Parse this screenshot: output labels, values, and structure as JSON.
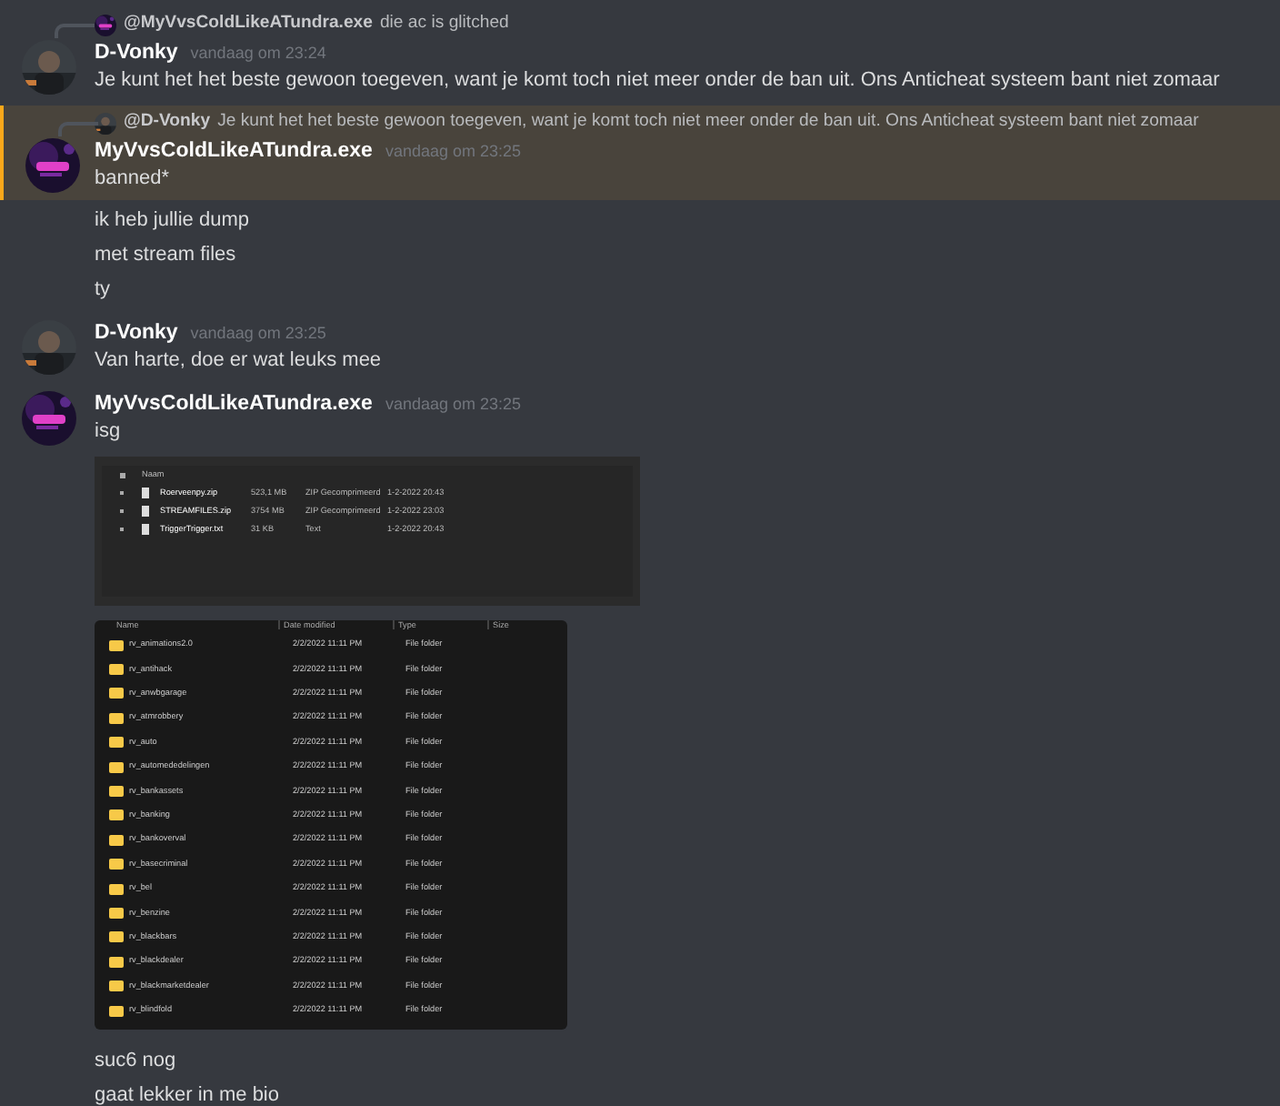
{
  "messages": [
    {
      "author": "D-Vonky",
      "time": "vandaag om 23:24",
      "highlighted": false,
      "reply": {
        "author": "@MyVvsColdLikeATundra.exe",
        "text": "die ac is glitched"
      },
      "content": [
        {
          "kind": "text",
          "text": "Je kunt het het beste gewoon toegeven, want je komt toch niet meer onder de ban uit. Ons Anticheat systeem bant niet zomaar"
        }
      ]
    },
    {
      "author": "MyVvsColdLikeATundra.exe",
      "time": "vandaag om 23:25",
      "highlighted": true,
      "reply": {
        "author": "@D-Vonky",
        "text": "Je kunt het het beste gewoon toegeven, want je komt toch niet meer onder de ban uit. Ons Anticheat systeem bant niet zomaar"
      },
      "content": [
        {
          "kind": "text",
          "text": "banned*"
        }
      ]
    },
    {
      "content": [
        {
          "kind": "text",
          "text": "ik heb jullie dump"
        },
        {
          "kind": "text",
          "text": "met stream files"
        },
        {
          "kind": "text",
          "text": "ty"
        }
      ]
    },
    {
      "author": "D-Vonky",
      "time": "vandaag om 23:25",
      "highlighted": false,
      "content": [
        {
          "kind": "text",
          "text": "Van harte, doe er wat leuks mee"
        }
      ]
    },
    {
      "author": "MyVvsColdLikeATundra.exe",
      "time": "vandaag om 23:25",
      "highlighted": false,
      "content": [
        {
          "kind": "text",
          "text": "isg"
        },
        {
          "kind": "archive-list",
          "header": "Naam",
          "rows": [
            {
              "name": "Roerveenpy.zip",
              "size": "523,1 MB",
              "type": "ZIP Gecomprimeerd",
              "date": "1-2-2022 20:43"
            },
            {
              "name": "STREAMFILES.zip",
              "size": "3754 MB",
              "type": "ZIP Gecomprimeerd",
              "date": "1-2-2022 23:03"
            },
            {
              "name": "TriggerTrigger.txt",
              "size": "31 KB",
              "type": "Text",
              "date": "1-2-2022 20:43"
            }
          ]
        },
        {
          "kind": "folder-list",
          "columns": [
            "Name",
            "Date modified",
            "Type",
            "Size"
          ],
          "rows": [
            {
              "name": "rv_animations2.0",
              "date": "2/2/2022 11:11 PM",
              "type": "File folder"
            },
            {
              "name": "rv_antihack",
              "date": "2/2/2022 11:11 PM",
              "type": "File folder"
            },
            {
              "name": "rv_anwbgarage",
              "date": "2/2/2022 11:11 PM",
              "type": "File folder"
            },
            {
              "name": "rv_atmrobbery",
              "date": "2/2/2022 11:11 PM",
              "type": "File folder"
            },
            {
              "name": "rv_auto",
              "date": "2/2/2022 11:11 PM",
              "type": "File folder"
            },
            {
              "name": "rv_automededelingen",
              "date": "2/2/2022 11:11 PM",
              "type": "File folder"
            },
            {
              "name": "rv_bankassets",
              "date": "2/2/2022 11:11 PM",
              "type": "File folder"
            },
            {
              "name": "rv_banking",
              "date": "2/2/2022 11:11 PM",
              "type": "File folder"
            },
            {
              "name": "rv_bankoverval",
              "date": "2/2/2022 11:11 PM",
              "type": "File folder"
            },
            {
              "name": "rv_basecriminal",
              "date": "2/2/2022 11:11 PM",
              "type": "File folder"
            },
            {
              "name": "rv_bel",
              "date": "2/2/2022 11:11 PM",
              "type": "File folder"
            },
            {
              "name": "rv_benzine",
              "date": "2/2/2022 11:11 PM",
              "type": "File folder"
            },
            {
              "name": "rv_blackbars",
              "date": "2/2/2022 11:11 PM",
              "type": "File folder"
            },
            {
              "name": "rv_blackdealer",
              "date": "2/2/2022 11:11 PM",
              "type": "File folder"
            },
            {
              "name": "rv_blackmarketdealer",
              "date": "2/2/2022 11:11 PM",
              "type": "File folder"
            },
            {
              "name": "rv_blindfold",
              "date": "2/2/2022 11:11 PM",
              "type": "File folder"
            }
          ]
        },
        {
          "kind": "text",
          "text": "suc6 nog"
        },
        {
          "kind": "text",
          "text": "gaat lekker in me bio"
        }
      ]
    }
  ]
}
